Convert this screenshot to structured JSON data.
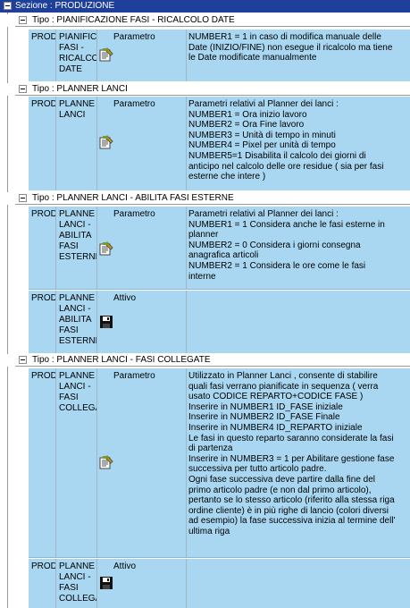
{
  "section": {
    "label": "Sezione : PRODUZIONE"
  },
  "groups": [
    {
      "type_label": "Tipo : PIANIFICAZIONE FASI - RICALCOLO DATE",
      "rows": [
        {
          "c1": "PROD",
          "c2": "PIANIFIC\nFASI -\nRICALCO\nDATE",
          "c3": "Parametro",
          "icon": "parameter-icon",
          "c4": "NUMBER1 = 1 in caso di modifica manuale delle\nDate (INIZIO/FINE) non esegue il ricalcolo ma tiene\nle Date modificate manualmente"
        }
      ]
    },
    {
      "type_label": "Tipo : PLANNER LANCI",
      "rows": [
        {
          "c1": "PROD",
          "c2": "PLANNE\nLANCI",
          "c3": "Parametro",
          "icon": "parameter-icon",
          "c4": "Parametri relativi al Planner dei lanci :\nNUMBER1 = Ora inizio lavoro\nNUMBER2 = Ora Fine lavoro\nNUMBER3 = Unità di tempo in minuti\nNUMBER4 = Pixel per unità di tempo\nNUMBER5=1 Disabilita il calcolo dei giorni di\nanticipo nel calcolo delle ore residue ( sia per fasi\nesterne che intere )"
        }
      ]
    },
    {
      "type_label": "Tipo : PLANNER LANCI - ABILITA FASI ESTERNE",
      "rows": [
        {
          "c1": "PROD",
          "c2": "PLANNE\nLANCI -\nABILITA\nFASI\nESTERNI",
          "c3": "Parametro",
          "icon": "parameter-icon",
          "c4": "Parametri relativi al Planner dei lanci :\nNUMBER1 = 1  Considera anche le fasi esterne in\nplanner\nNUMBER2 = 0  Considera i giorni consegna\nanagrafica articoli\nNUMBER2 = 1  Considera le ore come le fasi\ninterne"
        },
        {
          "c1": "PROD",
          "c2": "PLANNE\nLANCI -\nABILITA\nFASI\nESTERNI",
          "c3": "Attivo",
          "icon": "save-icon",
          "c4": ""
        }
      ]
    },
    {
      "type_label": "Tipo : PLANNER LANCI - FASI COLLEGATE",
      "rows": [
        {
          "c1": "PROD",
          "c2": "PLANNE\nLANCI -\nFASI\nCOLLEGA",
          "c3": "Parametro",
          "icon": "parameter-icon",
          "c4": "Utilizzato in Planner Lanci , consente di stabilire\nquali fasi verrano pianificate in sequenza ( verra\nusato CODICE REPARTO+CODICE FASE )\nInserire in NUMBER1 ID_FASE iniziale\nInserire in NUMBER2 ID_FASE Finale\nInserire in NUMBER4 ID_REPARTO iniziale\nLe fasi in questo reparto saranno considerate la fasi\ndi partenza\nInserire in NUMBER3 = 1 per Abilitare gestione fase\nsuccessiva per tutto articolo padre.\nOgni fase successiva deve partire dalla fine del\nprimo articolo padre (e non dal primo articolo),\npertanto se lo stesso articolo (riferito alla stessa riga\nordine cliente) è in più righe di lancio (colori diversi\nad esempio) la fase successiva inizia al termine dell'\nultima riga"
        },
        {
          "c1": "PROD",
          "c2": "PLANNE\nLANCI -\nFASI\nCOLLEGA",
          "c3": "Attivo",
          "icon": "save-icon",
          "c4": ""
        }
      ]
    }
  ]
}
